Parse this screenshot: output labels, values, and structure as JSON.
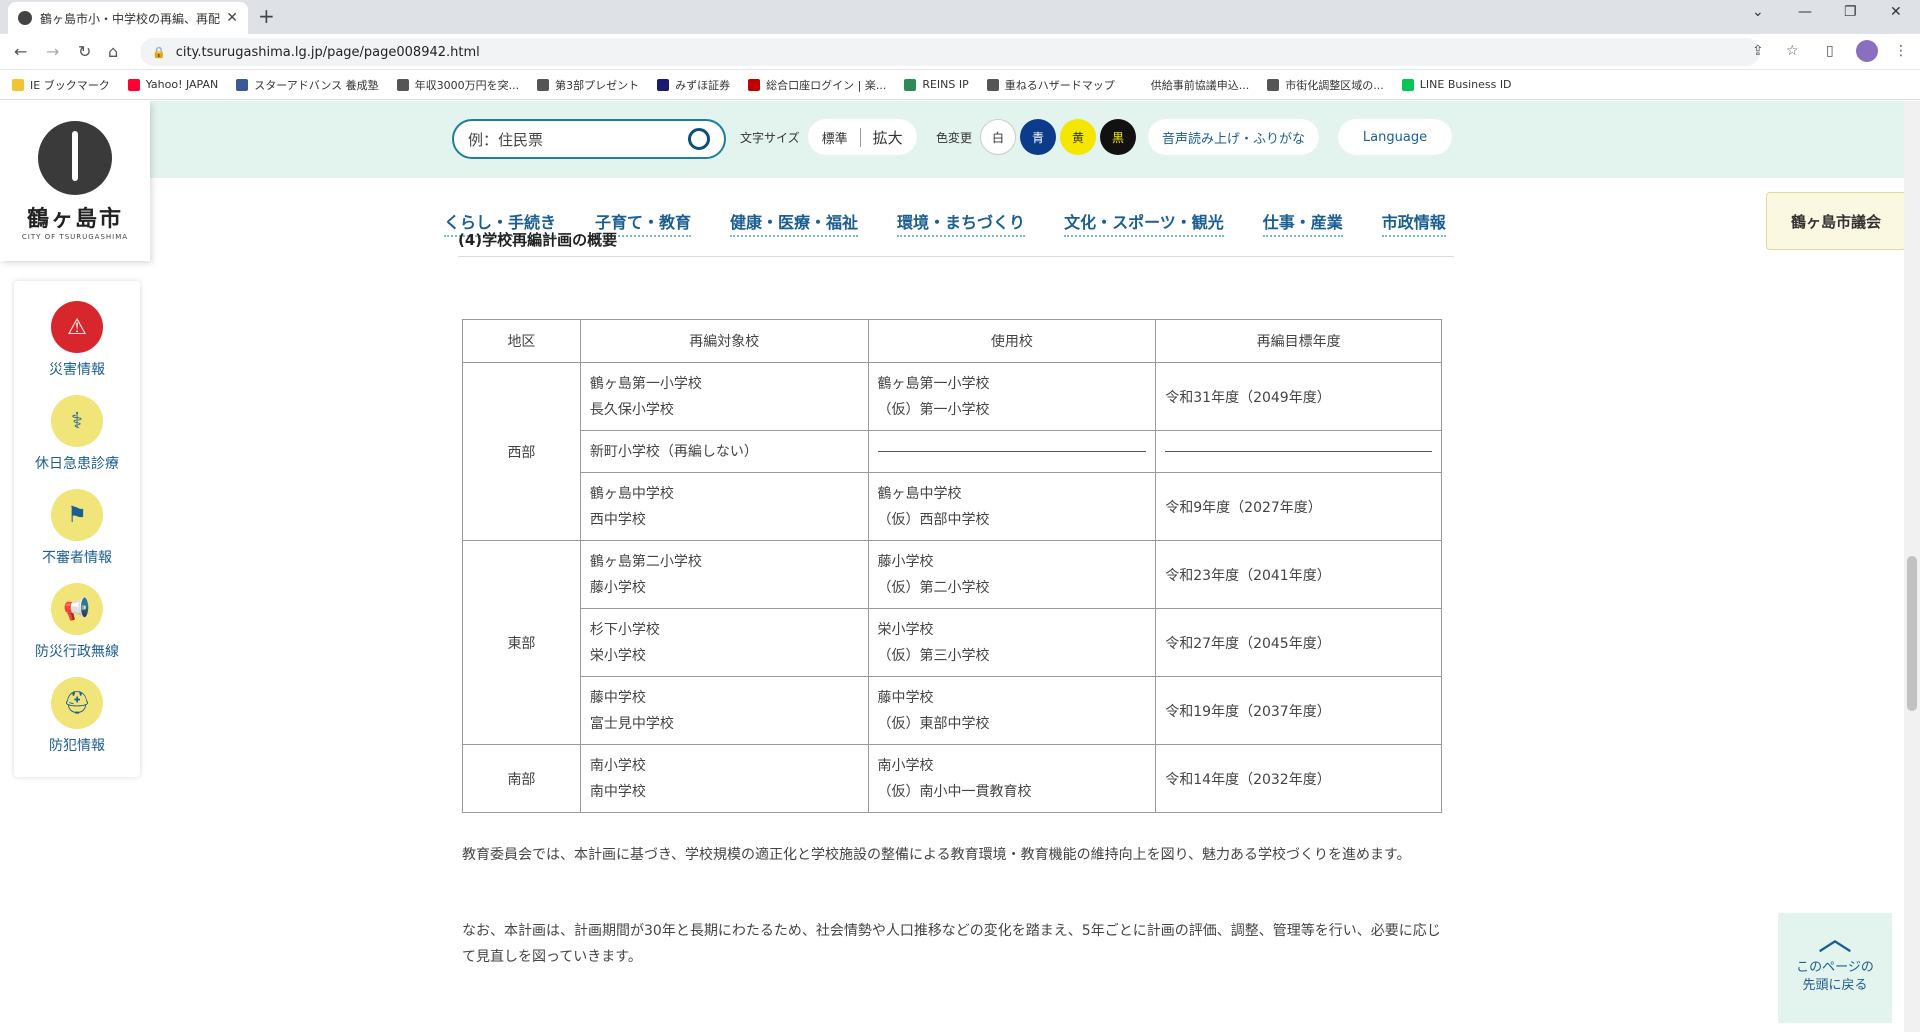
{
  "browser": {
    "tab_title": "鶴ヶ島市小・中学校の再編、再配置",
    "url": "city.tsurugashima.lg.jp/page/page008942.html",
    "bookmarks": [
      {
        "label": "IE ブックマーク",
        "color": "#f4c430"
      },
      {
        "label": "Yahoo! JAPAN",
        "color": "#ff0033"
      },
      {
        "label": "スターアドバンス 養成塾",
        "color": "#3b5998"
      },
      {
        "label": "年収3000万円を突...",
        "color": "#555555"
      },
      {
        "label": "第3部プレゼント",
        "color": "#555555"
      },
      {
        "label": "みずほ証券",
        "color": "#1a1a6e"
      },
      {
        "label": "総合口座ログイン | 楽...",
        "color": "#bf0000"
      },
      {
        "label": "REINS IP",
        "color": "#2e8b57"
      },
      {
        "label": "重ねるハザードマップ",
        "color": "#555555"
      },
      {
        "label": "供給事前協議申込...",
        "color": "#ffffff"
      },
      {
        "label": "市街化調整区域の...",
        "color": "#555555"
      },
      {
        "label": "LINE Business ID",
        "color": "#06c755"
      }
    ]
  },
  "site": {
    "logo_text": "鶴ヶ島市",
    "logo_sub": "CITY OF TSURUGASHIMA",
    "search_placeholder": "例：住民票",
    "font_size_label": "文字サイズ",
    "font_std": "標準",
    "font_large": "拡大",
    "color_change_label": "色変更",
    "colors": [
      {
        "label": "白",
        "bg": "#ffffff",
        "fg": "#333333"
      },
      {
        "label": "青",
        "bg": "#0d3b8c",
        "fg": "#ffffff"
      },
      {
        "label": "黄",
        "bg": "#f5e600",
        "fg": "#333333"
      },
      {
        "label": "黒",
        "bg": "#111111",
        "fg": "#f5e600"
      }
    ],
    "voice_button": "音声読み上げ・ふりがな",
    "language_button": "Language",
    "gikai_button": "鶴ヶ島市議会",
    "nav": [
      "くらし・手続き",
      "子育て・教育",
      "健康・医療・福祉",
      "環境・まちづくり",
      "文化・スポーツ・観光",
      "仕事・産業",
      "市政情報"
    ]
  },
  "sidebar": [
    {
      "label": "災害情報",
      "icon": "warning-icon",
      "bg": "#d7262c",
      "glyph": "⚠"
    },
    {
      "label": "休日急患診療",
      "icon": "stethoscope-icon",
      "bg": "#f1e479",
      "glyph": "⚕"
    },
    {
      "label": "不審者情報",
      "icon": "person-alert-icon",
      "bg": "#f1e479",
      "glyph": "⚑"
    },
    {
      "label": "防災行政無線",
      "icon": "megaphone-icon",
      "bg": "#f1e479",
      "glyph": "📢"
    },
    {
      "label": "防犯情報",
      "icon": "helmet-icon",
      "bg": "#f1e479",
      "glyph": "⛑"
    }
  ],
  "section_title": "(4)学校再編計画の概要",
  "table": {
    "headers": [
      "地区",
      "再編対象校",
      "使用校",
      "再編目標年度"
    ],
    "groups": [
      {
        "area": "西部",
        "rows": [
          {
            "targets": [
              "鶴ヶ島第一小学校",
              "長久保小学校"
            ],
            "use": [
              "鶴ヶ島第一小学校",
              "（仮）第一小学校"
            ],
            "year": "令和31年度（2049年度）"
          },
          {
            "targets": [
              "新町小学校（再編しない）"
            ],
            "use": [],
            "year": ""
          },
          {
            "targets": [
              "鶴ヶ島中学校",
              "西中学校"
            ],
            "use": [
              "鶴ヶ島中学校",
              "（仮）西部中学校"
            ],
            "year": "令和9年度（2027年度）"
          }
        ]
      },
      {
        "area": "東部",
        "rows": [
          {
            "targets": [
              "鶴ヶ島第二小学校",
              "藤小学校"
            ],
            "use": [
              "藤小学校",
              "（仮）第二小学校"
            ],
            "year": "令和23年度（2041年度）"
          },
          {
            "targets": [
              "杉下小学校",
              "栄小学校"
            ],
            "use": [
              "栄小学校",
              "（仮）第三小学校"
            ],
            "year": "令和27年度（2045年度）"
          },
          {
            "targets": [
              "藤中学校",
              "富士見中学校"
            ],
            "use": [
              "藤中学校",
              "（仮）東部中学校"
            ],
            "year": "令和19年度（2037年度）"
          }
        ]
      },
      {
        "area": "南部",
        "rows": [
          {
            "targets": [
              "南小学校",
              "南中学校"
            ],
            "use": [
              "南小学校",
              "（仮）南小中一貫教育校"
            ],
            "year": "令和14年度（2032年度）"
          }
        ]
      }
    ]
  },
  "paragraphs": [
    "教育委員会では、本計画に基づき、学校規模の適正化と学校施設の整備による教育環境・教育機能の維持向上を図り、魅力ある学校づくりを進めます。",
    "なお、本計画は、計画期間が30年と長期にわたるため、社会情勢や人口推移などの変化を踏まえ、5年ごとに計画の評価、調整、管理等を行い、必要に応じて見直しを図っていきます。"
  ],
  "to_top": {
    "line1": "このページの",
    "line2": "先頭に戻る"
  }
}
